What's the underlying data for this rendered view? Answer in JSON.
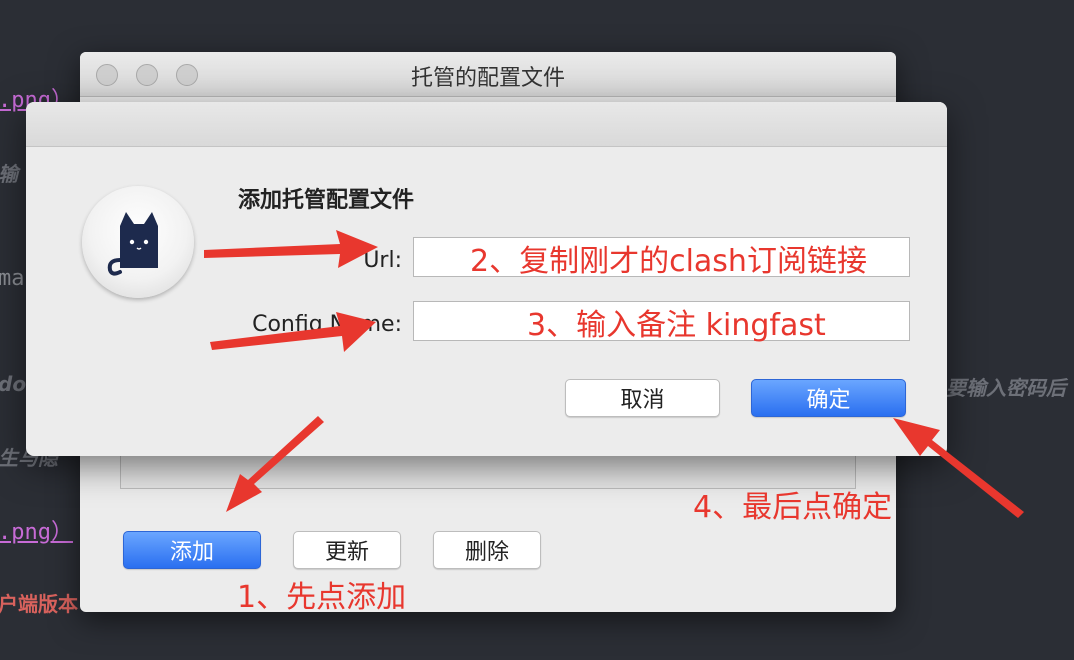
{
  "background": {
    "fragments": [
      {
        "id": "png1",
        "text": ".png）"
      },
      {
        "id": "input1",
        "text": "输"
      },
      {
        "id": "mas",
        "text": "mas"
      },
      {
        "id": "do",
        "text": "do"
      },
      {
        "id": "privacy",
        "text": "生与隐"
      },
      {
        "id": "png2",
        "text": ".png）"
      },
      {
        "id": "client",
        "text": "户端版本"
      },
      {
        "id": "pwd",
        "text": "要输入密码后"
      }
    ]
  },
  "back_window": {
    "title": "托管的配置文件",
    "buttons": {
      "add": "添加",
      "update": "更新",
      "delete": "删除"
    }
  },
  "dialog": {
    "heading": "添加托管配置文件",
    "url_label": "Url:",
    "url_value": "",
    "config_name_label": "Config Name:",
    "config_name_value": "",
    "cancel": "取消",
    "confirm": "确定",
    "icon": "clash-cat-icon"
  },
  "annotations": {
    "step1": "1、先点添加",
    "step2": "2、复制刚才的clash订阅链接",
    "step3": "3、输入备注 kingfast",
    "step4": "4、最后点确定"
  },
  "colors": {
    "annotation": "#e8372e",
    "accent": "#2a6ff0"
  }
}
